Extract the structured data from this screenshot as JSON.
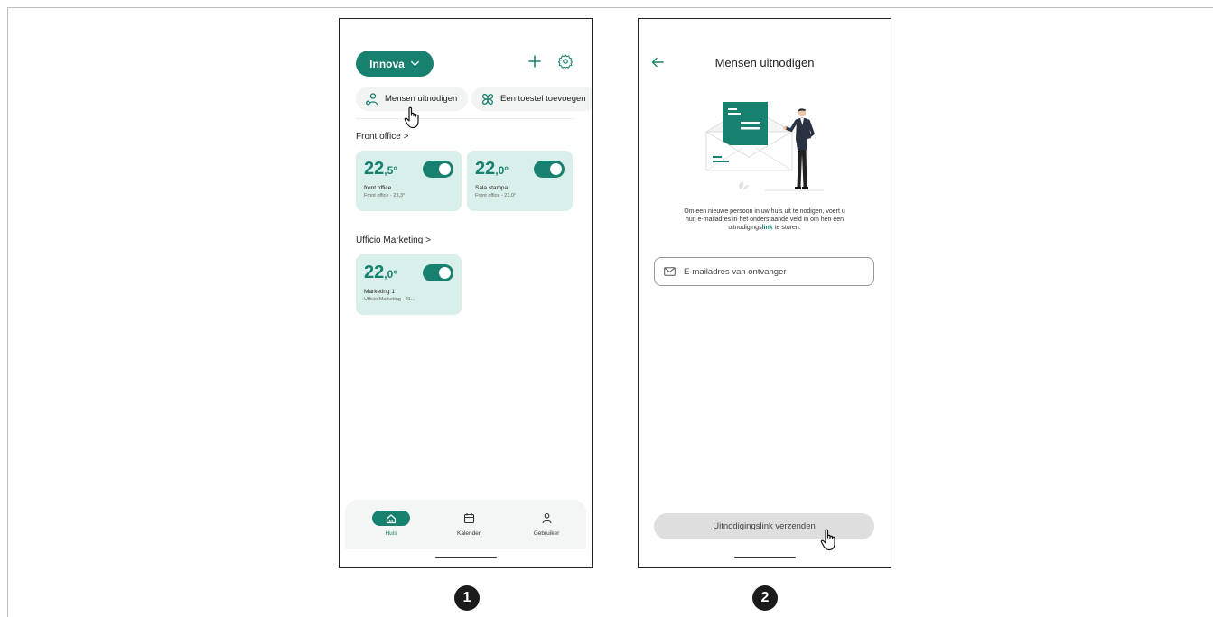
{
  "screen1": {
    "home_selector": "Innova",
    "chips": {
      "invite": "Mensen uitnodigen",
      "add_device": "Een toestel toevoegen"
    },
    "rooms": [
      {
        "title": "Front office >",
        "devices": [
          {
            "temp_int": "22",
            "temp_dec": ",5°",
            "name": "front office",
            "sub": "Front office - 23,3°",
            "on": true
          },
          {
            "temp_int": "22",
            "temp_dec": ",0°",
            "name": "Sala stampa",
            "sub": "Front office - 23,0°",
            "on": true
          }
        ]
      },
      {
        "title": "Ufficio Marketing >",
        "devices": [
          {
            "temp_int": "22",
            "temp_dec": ",0°",
            "name": "Marketing 1",
            "sub": "Ufficio Marketing - 21...",
            "on": true
          }
        ]
      }
    ],
    "nav": {
      "home": "Huis",
      "calendar": "Kalender",
      "user": "Gebruiker"
    }
  },
  "screen2": {
    "title": "Mensen uitnodigen",
    "intro_line1": "Om een nieuwe persoon in uw huis uit te nodigen, voert u",
    "intro_line2": "hun e-mailadres in het onderstaande veld in om hen een",
    "intro_line3_before": "uitnodigings",
    "intro_link": "link",
    "intro_line3_after": " te sturen.",
    "email_placeholder": "E-mailadres van ontvanger",
    "send_button": "Uitnodigingslink verzenden"
  },
  "steps": [
    "1",
    "2"
  ],
  "colors": {
    "accent": "#17806f",
    "card_bg": "#d8efeb",
    "chip_bg": "#f2f3f3",
    "disabled_button": "#dedede"
  }
}
